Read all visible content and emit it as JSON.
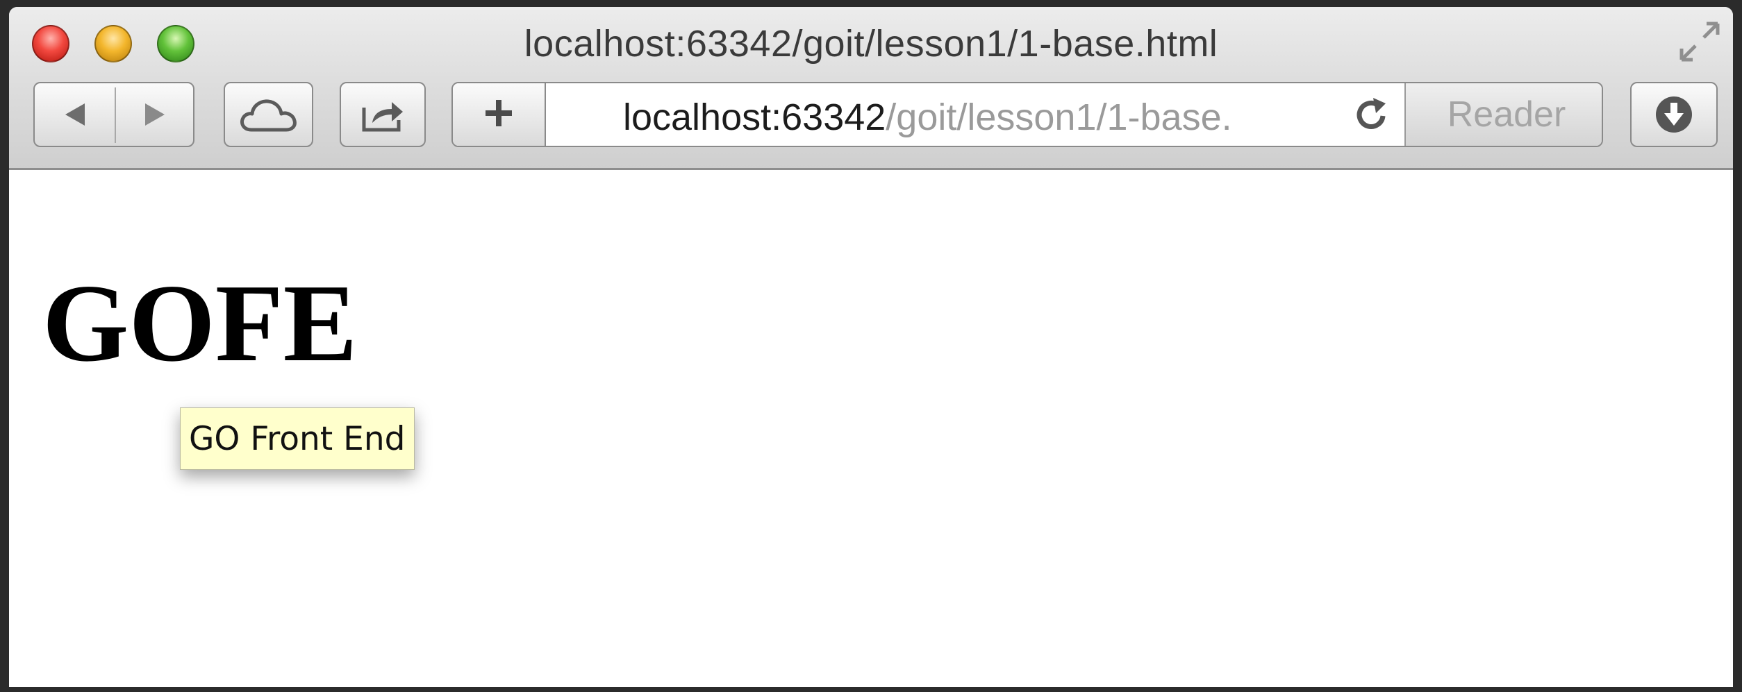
{
  "window": {
    "title": "localhost:63342/goit/lesson1/1-base.html"
  },
  "toolbar": {
    "back_icon": "back-arrow-icon",
    "forward_icon": "forward-arrow-icon",
    "cloud_icon": "icloud-tabs-icon",
    "share_icon": "share-icon",
    "add_icon": "plus-icon",
    "reload_icon": "reload-icon",
    "download_icon": "downloads-icon",
    "reader_label": "Reader"
  },
  "address_bar": {
    "host": "localhost:63342",
    "path": "/goit/lesson1/1-base."
  },
  "page": {
    "heading": "GOFE",
    "tooltip": "GO Front End"
  },
  "colors": {
    "tooltip_bg": "#ffffcc",
    "close": "#f2483f",
    "minimize": "#f3b62c",
    "zoom": "#62c23a"
  }
}
